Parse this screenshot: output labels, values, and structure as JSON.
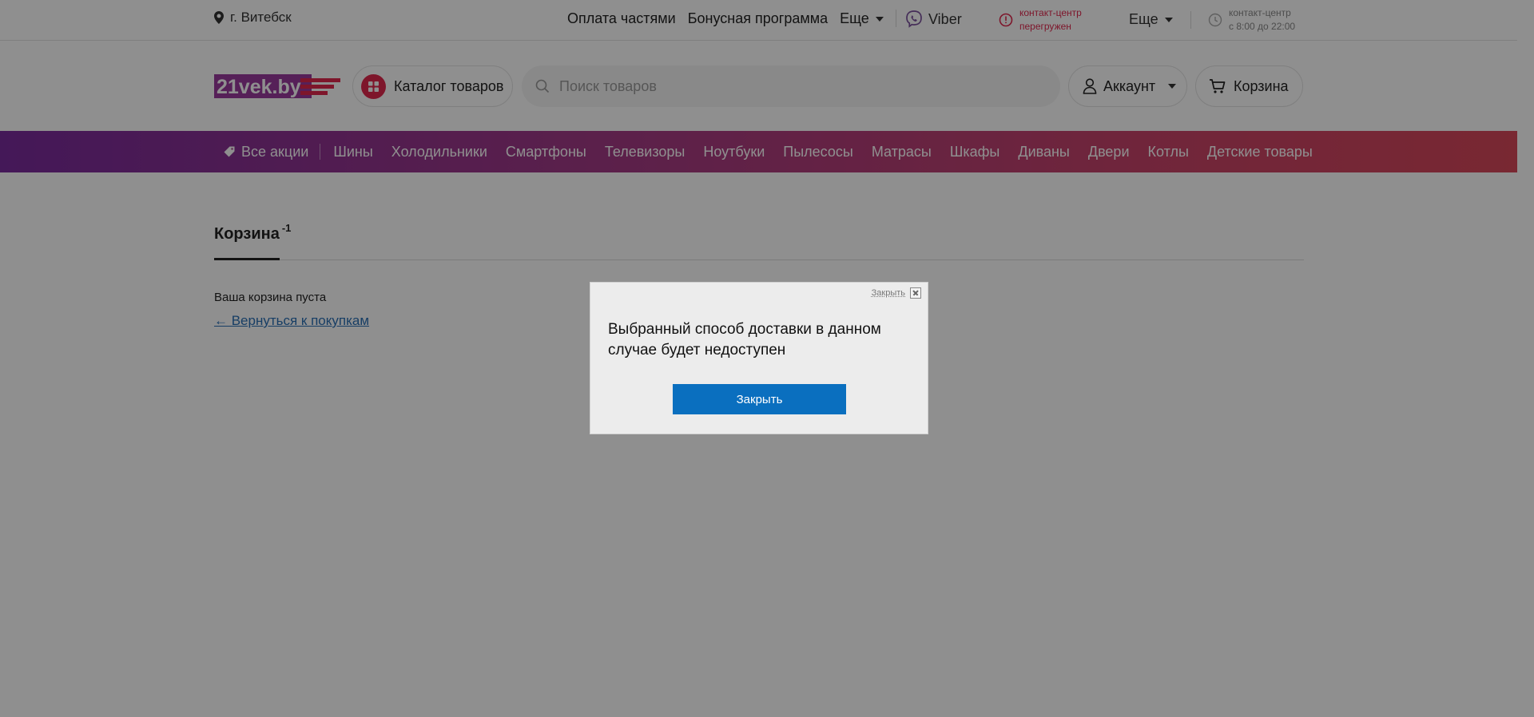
{
  "topbar": {
    "city": "г. Витебск",
    "links": [
      "Оплата частями",
      "Бонусная программа"
    ],
    "more_label": "Еще",
    "viber_label": "Viber",
    "contact_warning_line1": "контакт-центр",
    "contact_warning_line2": "перегружен",
    "more2_label": "Еще",
    "hours_line1": "контакт-центр",
    "hours_line2": "с 8:00 до 22:00"
  },
  "header": {
    "logo_text": "21vek.by",
    "catalog_label": "Каталог товаров",
    "search_placeholder": "Поиск товаров",
    "account_label": "Аккаунт",
    "cart_label": "Корзина"
  },
  "catnav": {
    "promo_label": "Все акции",
    "categories": [
      "Шины",
      "Холодильники",
      "Смартфоны",
      "Телевизоры",
      "Ноутбуки",
      "Пылесосы",
      "Матрасы",
      "Шкафы",
      "Диваны",
      "Двери",
      "Котлы",
      "Детские товары"
    ]
  },
  "cart": {
    "tab_label": "Корзина",
    "tab_count": "-1",
    "empty_text": "Ваша корзина пуста",
    "back_link": "← Вернуться к покупкам"
  },
  "modal": {
    "close_top_label": "Закрыть",
    "message": "Выбранный способ доставки в данном случае будет недоступен",
    "close_button_label": "Закрыть"
  },
  "colors": {
    "accent": "#e0284e",
    "nav_gradient_start": "#7a2b9d",
    "nav_gradient_end": "#d8485a",
    "modal_button": "#0a6fbf",
    "link": "#2a6fb5"
  },
  "icons": [
    "location-pin-icon",
    "viber-icon",
    "warning-icon",
    "clock-icon",
    "catalog-grid-icon",
    "search-icon",
    "user-icon",
    "cart-icon",
    "tag-icon",
    "close-icon"
  ]
}
